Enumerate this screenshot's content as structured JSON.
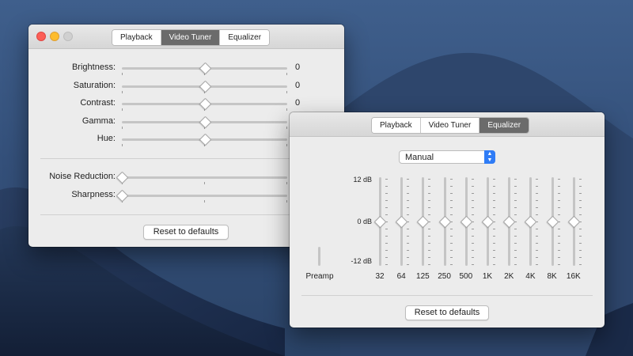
{
  "colors": {
    "accent": "#2f7cf6",
    "tab_active": "#6b6b6b"
  },
  "video_tuner": {
    "tabs": [
      "Playback",
      "Video Tuner",
      "Equalizer"
    ],
    "active_tab": 1,
    "sliders": [
      {
        "label": "Brightness:",
        "value": "0",
        "fraction": 0.5,
        "centered": true
      },
      {
        "label": "Saturation:",
        "value": "0",
        "fraction": 0.5,
        "centered": true
      },
      {
        "label": "Contrast:",
        "value": "0",
        "fraction": 0.5,
        "centered": true
      },
      {
        "label": "Gamma:",
        "value": "0",
        "fraction": 0.5,
        "centered": true
      },
      {
        "label": "Hue:",
        "value": "0",
        "fraction": 0.5,
        "centered": true
      }
    ],
    "sliders2": [
      {
        "label": "Noise Reduction:",
        "value": "0",
        "fraction": 0.0
      },
      {
        "label": "Sharpness:",
        "value": "0",
        "fraction": 0.0
      }
    ],
    "reset_label": "Reset to defaults"
  },
  "equalizer": {
    "tabs": [
      "Playback",
      "Video Tuner",
      "Equalizer"
    ],
    "active_tab": 2,
    "preset": "Manual",
    "db_labels": {
      "top": "12 dB",
      "mid": "0 dB",
      "bottom": "-12 dB"
    },
    "preamp_label": "Preamp",
    "bands": [
      {
        "label": "32",
        "gain_db": 0
      },
      {
        "label": "64",
        "gain_db": 0
      },
      {
        "label": "125",
        "gain_db": 0
      },
      {
        "label": "250",
        "gain_db": 0
      },
      {
        "label": "500",
        "gain_db": 0
      },
      {
        "label": "1K",
        "gain_db": 0
      },
      {
        "label": "2K",
        "gain_db": 0
      },
      {
        "label": "4K",
        "gain_db": 0
      },
      {
        "label": "8K",
        "gain_db": 0
      },
      {
        "label": "16K",
        "gain_db": 0
      }
    ],
    "reset_label": "Reset to defaults"
  }
}
